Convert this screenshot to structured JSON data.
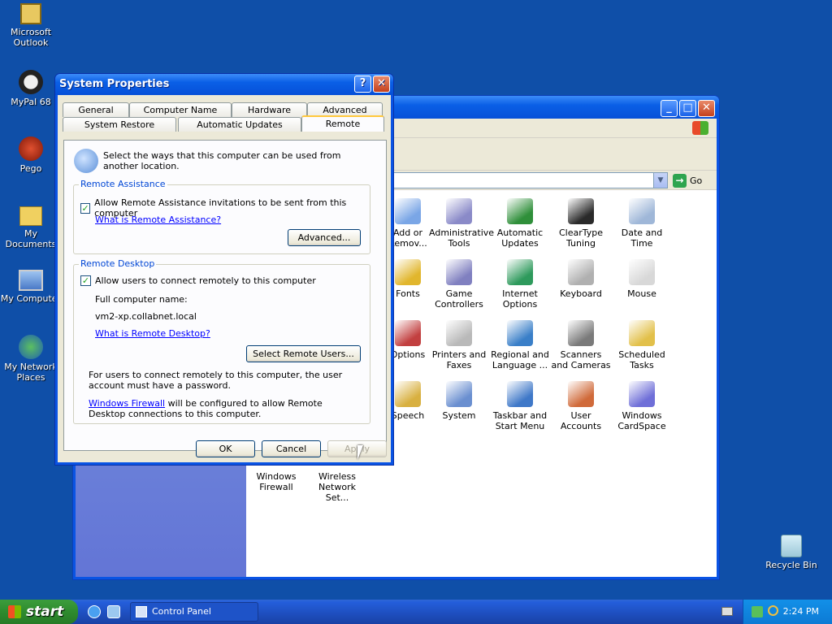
{
  "desktop": {
    "icons": [
      {
        "label": "Microsoft Outlook",
        "icon": "outlook-icon"
      },
      {
        "label": "MyPal 68",
        "icon": "mypal-icon"
      },
      {
        "label": "Pego",
        "icon": "pego-icon"
      },
      {
        "label": "My Documents",
        "icon": "my-documents-icon"
      },
      {
        "label": "My Computer",
        "icon": "my-computer-icon"
      },
      {
        "label": "My Network Places",
        "icon": "network-places-icon"
      },
      {
        "label": "Recycle Bin",
        "icon": "recycle-bin-icon"
      }
    ]
  },
  "control_panel": {
    "go_label": "Go",
    "items": [
      {
        "label": "Add or Remov...",
        "color": "#7aa6e6"
      },
      {
        "label": "Administrative Tools",
        "color": "#8a8ac8"
      },
      {
        "label": "Automatic Updates",
        "color": "#2f8f3a"
      },
      {
        "label": "ClearType Tuning",
        "color": "#2a2a2a"
      },
      {
        "label": "Date and Time",
        "color": "#9fb7d8"
      },
      {
        "label": "Fonts",
        "color": "#e1b62d"
      },
      {
        "label": "Game Controllers",
        "color": "#8080c0"
      },
      {
        "label": "Internet Options",
        "color": "#2e9a5c"
      },
      {
        "label": "Keyboard",
        "color": "#b0b0b0"
      },
      {
        "label": "Mouse",
        "color": "#d8d8d8"
      },
      {
        "label": "Options",
        "color": "#c24040"
      },
      {
        "label": "Printers and Faxes",
        "color": "#b9b9b9"
      },
      {
        "label": "Regional and Language ...",
        "color": "#3a7fc8"
      },
      {
        "label": "Scanners and Cameras",
        "color": "#7a7a7a"
      },
      {
        "label": "Scheduled Tasks",
        "color": "#e2c04a"
      },
      {
        "label": "Speech",
        "color": "#d8b040"
      },
      {
        "label": "System",
        "color": "#6a8fd0"
      },
      {
        "label": "Taskbar and Start Menu",
        "color": "#3f78c8"
      },
      {
        "label": "User Accounts",
        "color": "#d06a3a"
      },
      {
        "label": "Windows CardSpace",
        "color": "#6f6fd8"
      },
      {
        "label": "Windows Firewall",
        "color": "#c0503a"
      },
      {
        "label": "Wireless Network Set...",
        "color": "#3a8ad0"
      }
    ]
  },
  "dialog": {
    "title": "System Properties",
    "help_button": "?",
    "close_button": "✕",
    "tabs_row1": [
      "General",
      "Computer Name",
      "Hardware",
      "Advanced"
    ],
    "tabs_row2": [
      "System Restore",
      "Automatic Updates",
      "Remote"
    ],
    "intro": "Select the ways that this computer can be used from another location.",
    "remote_assistance": {
      "group_label": "Remote Assistance",
      "checkbox_label": "Allow Remote Assistance invitations to be sent from this computer",
      "checked": true,
      "link": "What is Remote Assistance?",
      "advanced_button": "Advanced..."
    },
    "remote_desktop": {
      "group_label": "Remote Desktop",
      "checkbox_label": "Allow users to connect remotely to this computer",
      "checked": true,
      "full_name_label": "Full computer name:",
      "full_name_value": "vm2-xp.collabnet.local",
      "link": "What is Remote Desktop?",
      "select_users_button": "Select Remote Users...",
      "password_note": "For users to connect remotely to this computer, the user account must have a password.",
      "firewall_link": "Windows Firewall",
      "firewall_note": " will be configured to allow Remote Desktop connections to this computer."
    },
    "ok_button": "OK",
    "cancel_button": "Cancel",
    "apply_button": "Apply"
  },
  "taskbar": {
    "start_label": "start",
    "task_label": "Control Panel",
    "clock": "2:24 PM"
  },
  "colors": {
    "desktop": "#0f4fa8",
    "title_bar": "#0a5fe6",
    "link": "#0000ff"
  }
}
